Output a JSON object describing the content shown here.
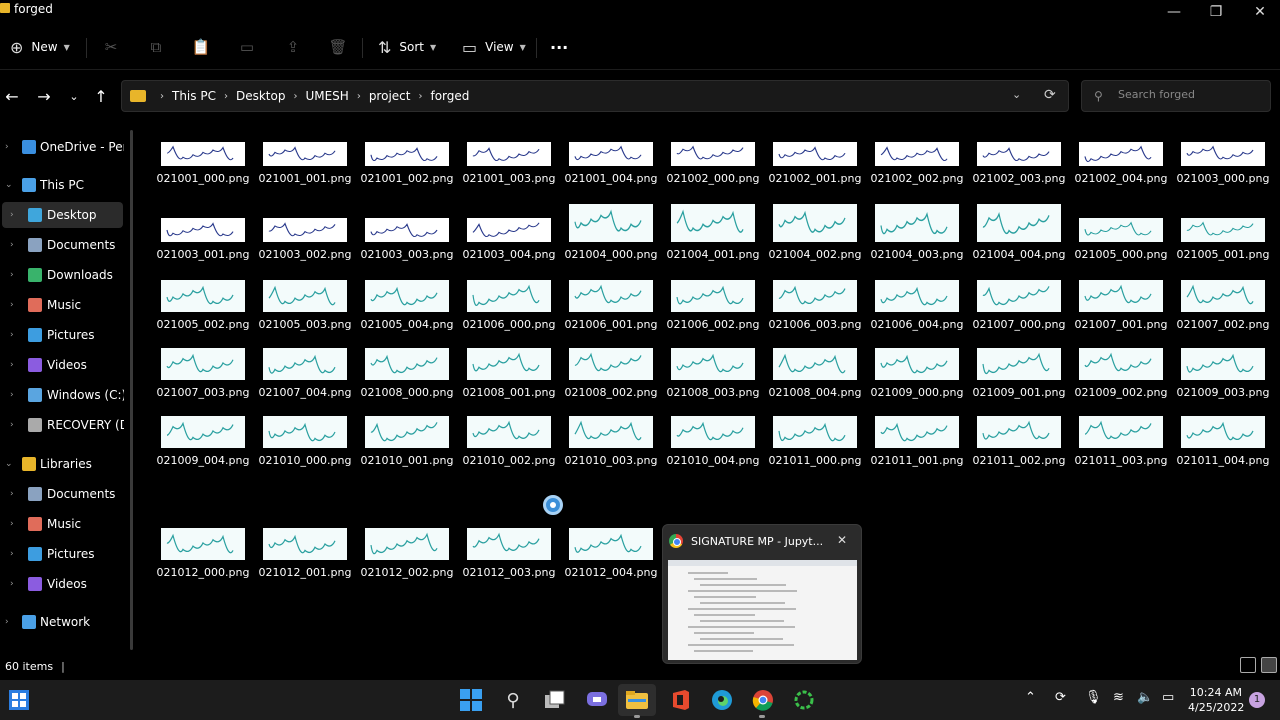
{
  "window": {
    "title": "forged",
    "min_glyph": "—",
    "max_glyph": "❐",
    "close_glyph": "✕"
  },
  "commands": {
    "new_label": "New",
    "sort_label": "Sort",
    "view_label": "View",
    "more_glyph": "···"
  },
  "address": {
    "breadcrumbs": [
      "This PC",
      "Desktop",
      "UMESH",
      "project",
      "forged"
    ]
  },
  "search": {
    "placeholder": "Search forged"
  },
  "sidebar": {
    "items": [
      {
        "label": "OneDrive - Perso",
        "icon": "cloud-icon",
        "color": "#3a8fe0"
      },
      {
        "label": "This PC",
        "icon": "computer-icon",
        "color": "#4aa0e6"
      },
      {
        "label": "Desktop",
        "icon": "desktop-icon",
        "color": "#3fa6dc"
      },
      {
        "label": "Documents",
        "icon": "documents-icon",
        "color": "#8aa2c0"
      },
      {
        "label": "Downloads",
        "icon": "downloads-icon",
        "color": "#39b36b"
      },
      {
        "label": "Music",
        "icon": "music-icon",
        "color": "#e06c5a"
      },
      {
        "label": "Pictures",
        "icon": "pictures-icon",
        "color": "#3d9de0"
      },
      {
        "label": "Videos",
        "icon": "videos-icon",
        "color": "#8b5ce0"
      },
      {
        "label": "Windows (C:)",
        "icon": "drive-icon",
        "color": "#5aa5e0"
      },
      {
        "label": "RECOVERY (D:)",
        "icon": "drive-icon",
        "color": "#aaaaaa"
      },
      {
        "label": "Libraries",
        "icon": "libraries-icon",
        "color": "#e8b52a"
      },
      {
        "label": "Documents",
        "icon": "documents-icon",
        "color": "#8aa2c0"
      },
      {
        "label": "Music",
        "icon": "music-icon",
        "color": "#e06c5a"
      },
      {
        "label": "Pictures",
        "icon": "pictures-icon",
        "color": "#3d9de0"
      },
      {
        "label": "Videos",
        "icon": "videos-icon",
        "color": "#8b5ce0"
      },
      {
        "label": "Network",
        "icon": "network-icon",
        "color": "#4aa0e6"
      }
    ]
  },
  "files": [
    "021001_000.png",
    "021001_001.png",
    "021001_002.png",
    "021001_003.png",
    "021001_004.png",
    "021002_000.png",
    "021002_001.png",
    "021002_002.png",
    "021002_003.png",
    "021002_004.png",
    "021003_000.png",
    "021003_001.png",
    "021003_002.png",
    "021003_003.png",
    "021003_004.png",
    "021004_000.png",
    "021004_001.png",
    "021004_002.png",
    "021004_003.png",
    "021004_004.png",
    "021005_000.png",
    "021005_001.png",
    "021005_002.png",
    "021005_003.png",
    "021005_004.png",
    "021006_000.png",
    "021006_001.png",
    "021006_002.png",
    "021006_003.png",
    "021006_004.png",
    "021007_000.png",
    "021007_001.png",
    "021007_002.png",
    "021007_003.png",
    "021007_004.png",
    "021008_000.png",
    "021008_001.png",
    "021008_002.png",
    "021008_003.png",
    "021008_004.png",
    "021009_000.png",
    "021009_001.png",
    "021009_002.png",
    "021009_003.png",
    "021009_004.png",
    "021010_000.png",
    "021010_001.png",
    "021010_002.png",
    "021010_003.png",
    "021010_004.png",
    "021011_000.png",
    "021011_001.png",
    "021011_002.png",
    "021011_003.png",
    "021011_004.png",
    "021012_000.png",
    "021012_001.png",
    "021012_002.png",
    "021012_003.png",
    "021012_004.png"
  ],
  "preview": {
    "title": "SIGNATURE MP - Jupyt...",
    "close_glyph": "✕"
  },
  "status": {
    "item_count": "60 items"
  },
  "taskbar": {
    "apps": [
      "start-icon",
      "search-icon",
      "task-view-icon",
      "teams-chat-icon",
      "file-explorer-icon",
      "office-icon",
      "edge-icon",
      "chrome-icon",
      "loading-app-icon"
    ],
    "time": "10:24 AM",
    "date": "4/25/2022",
    "notification_count": "1"
  },
  "colors": {
    "signature_ink_blue": "#2a3a8c",
    "signature_ink_teal": "#2aa0a0",
    "thumb_bg": "#f3fbfb"
  }
}
